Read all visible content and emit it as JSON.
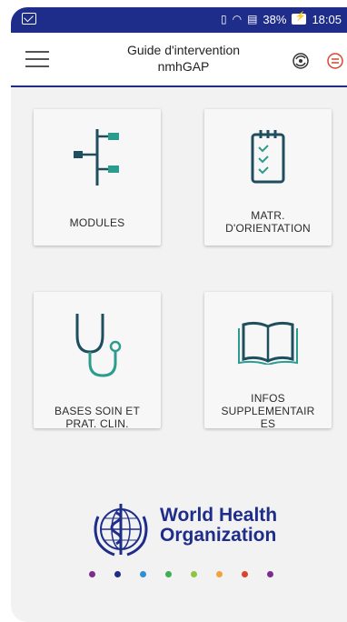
{
  "status": {
    "battery": "38%",
    "time": "18:05"
  },
  "header": {
    "title_line1": "Guide d'intervention",
    "title_line2": "nmhGAP"
  },
  "cards": [
    {
      "label": "MODULES",
      "icon": "tree-icon"
    },
    {
      "label_line1": "MATR.",
      "label_line2": "D'ORIENTATION",
      "icon": "clipboard-checklist-icon"
    },
    {
      "label_line1": "BASES SOIN ET",
      "label_line2": "PRAT. CLIN.",
      "icon": "stethoscope-icon"
    },
    {
      "label_line1": "INFOS",
      "label_line2": "SUPPLEMENTAIR",
      "label_line3": "ES",
      "icon": "open-book-icon"
    }
  ],
  "logo": {
    "line1": "World Health",
    "line2": "Organization"
  },
  "colors": {
    "statusbar": "#1f2d8a",
    "icon_dark": "#1f4e5f",
    "icon_accent": "#2a9d8f",
    "who_blue": "#1f2d8a"
  },
  "dot_colors": [
    "#7b2d8e",
    "#1f2d8a",
    "#2f8fd6",
    "#3fae55",
    "#8fc63f",
    "#f2a43a",
    "#d9452b",
    "#7b2d8e"
  ]
}
